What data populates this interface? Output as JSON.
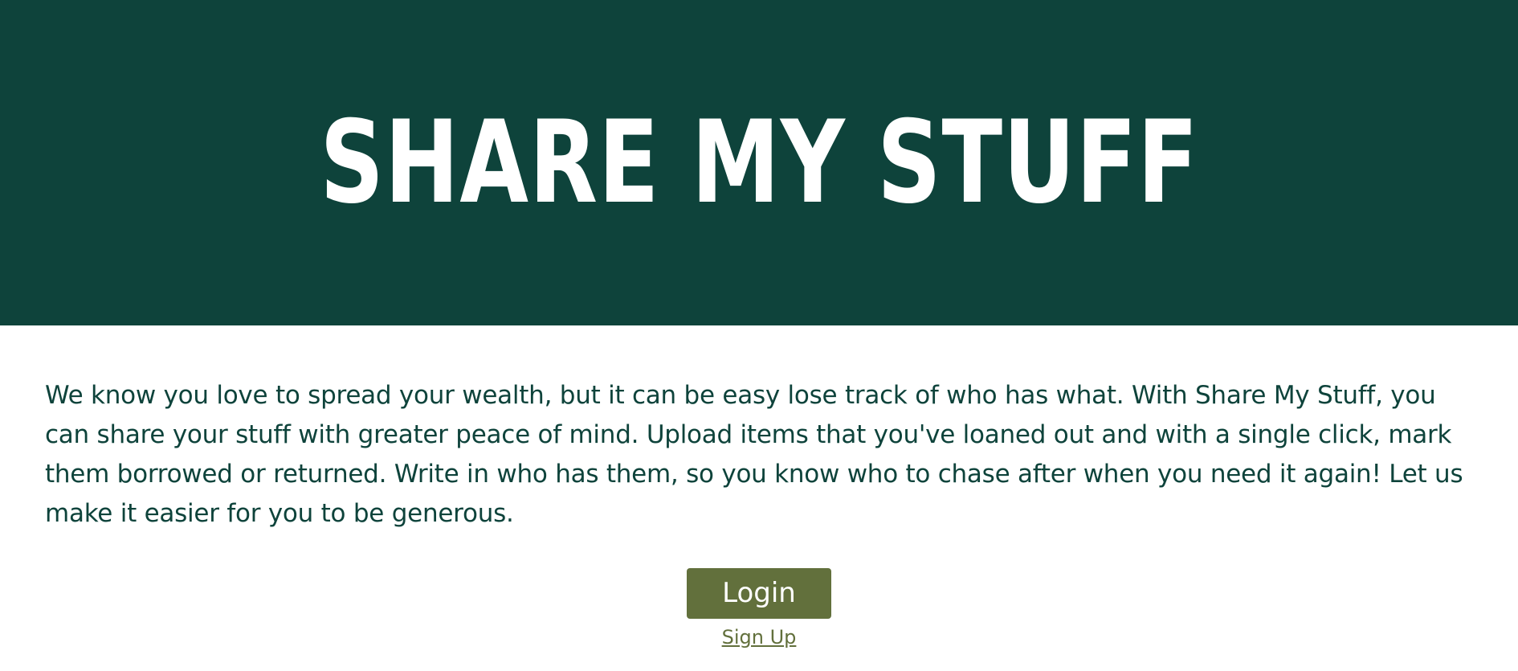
{
  "header": {
    "title": "SHARE MY STUFF"
  },
  "main": {
    "description": "We know you love to spread your wealth, but it can be easy lose track of who has what. With Share My Stuff, you can share your stuff with greater peace of mind. Upload items that you've loaned out and with a single click, mark them borrowed or returned. Write in who has them, so you know who to chase after when you need it again! Let us make it easier for you to be generous."
  },
  "actions": {
    "login_label": "Login",
    "signup_label": "Sign Up"
  },
  "colors": {
    "header_background": "#0e433b",
    "text": "#0e433b",
    "button_background": "#62703c",
    "button_text": "#ffffff",
    "link": "#62703c"
  }
}
